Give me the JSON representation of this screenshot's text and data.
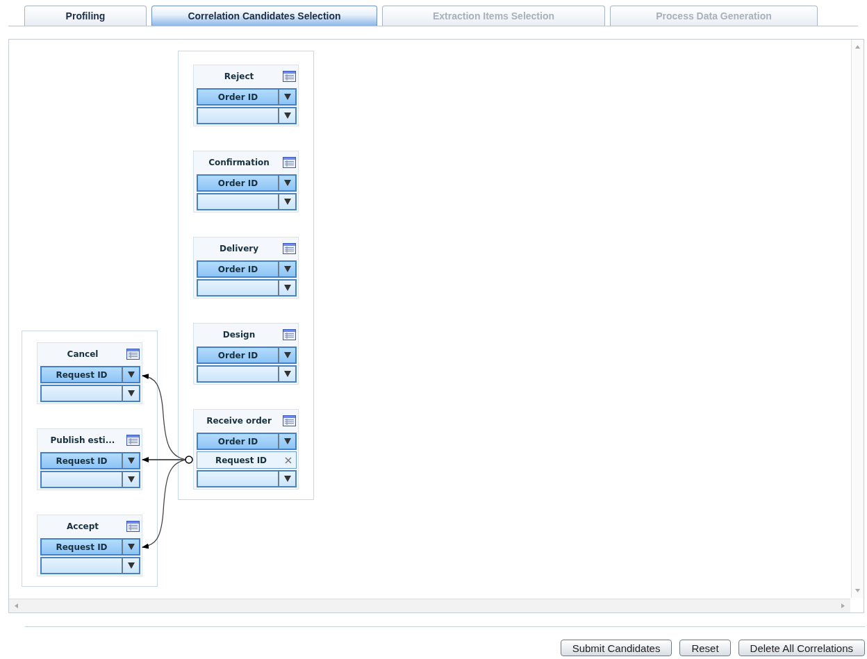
{
  "tabs": [
    {
      "label": "Profiling",
      "selected": false,
      "disabled": false
    },
    {
      "label": "Correlation Candidates Selection",
      "selected": true,
      "disabled": false
    },
    {
      "label": "Extraction Items Selection",
      "selected": false,
      "disabled": true
    },
    {
      "label": "Process Data Generation",
      "selected": false,
      "disabled": true
    }
  ],
  "diagram": {
    "groups": [
      {
        "nodes": [
          {
            "title": "Reject",
            "rows": [
              {
                "kind": "selected",
                "label": "Order ID"
              },
              {
                "kind": "empty"
              }
            ]
          },
          {
            "title": "Confirmation",
            "rows": [
              {
                "kind": "selected",
                "label": "Order ID"
              },
              {
                "kind": "empty"
              }
            ]
          },
          {
            "title": "Delivery",
            "rows": [
              {
                "kind": "selected",
                "label": "Order ID"
              },
              {
                "kind": "empty"
              }
            ]
          },
          {
            "title": "Design",
            "rows": [
              {
                "kind": "selected",
                "label": "Order ID"
              },
              {
                "kind": "empty"
              }
            ]
          },
          {
            "title": "Receive order",
            "rows": [
              {
                "kind": "selected",
                "label": "Order ID"
              },
              {
                "kind": "assigned",
                "label": "Request ID"
              },
              {
                "kind": "empty"
              }
            ]
          }
        ]
      },
      {
        "nodes": [
          {
            "title": "Cancel",
            "rows": [
              {
                "kind": "selected",
                "label": "Request ID"
              },
              {
                "kind": "empty"
              }
            ]
          },
          {
            "title": "Publish esti...",
            "rows": [
              {
                "kind": "selected",
                "label": "Request ID"
              },
              {
                "kind": "empty"
              }
            ]
          },
          {
            "title": "Accept",
            "rows": [
              {
                "kind": "selected",
                "label": "Request ID"
              },
              {
                "kind": "empty"
              }
            ]
          }
        ]
      }
    ]
  },
  "buttons": [
    "Submit Candidates",
    "Reset",
    "Delete All Correlations"
  ]
}
